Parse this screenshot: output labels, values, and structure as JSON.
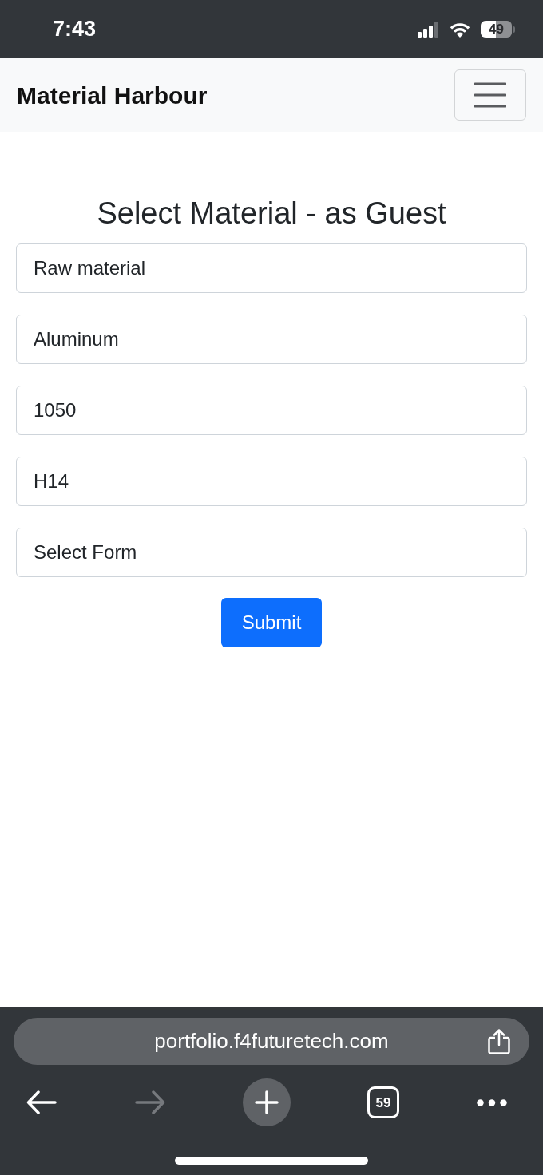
{
  "status_bar": {
    "time": "7:43",
    "battery": "49"
  },
  "navbar": {
    "brand": "Material Harbour"
  },
  "form": {
    "title": "Select Material - as Guest",
    "fields": [
      {
        "value": "Raw material"
      },
      {
        "value": "Aluminum"
      },
      {
        "value": "1050"
      },
      {
        "value": "H14"
      },
      {
        "value": "Select Form"
      }
    ],
    "submit": "Submit"
  },
  "browser": {
    "url": "portfolio.f4futuretech.com",
    "toolbar": [
      {
        "kind": "back",
        "disabled": false
      },
      {
        "kind": "forward",
        "disabled": true
      },
      {
        "kind": "new_tab",
        "disabled": false
      },
      {
        "kind": "tabs",
        "count": "59",
        "disabled": false
      },
      {
        "kind": "more",
        "disabled": false
      }
    ]
  }
}
